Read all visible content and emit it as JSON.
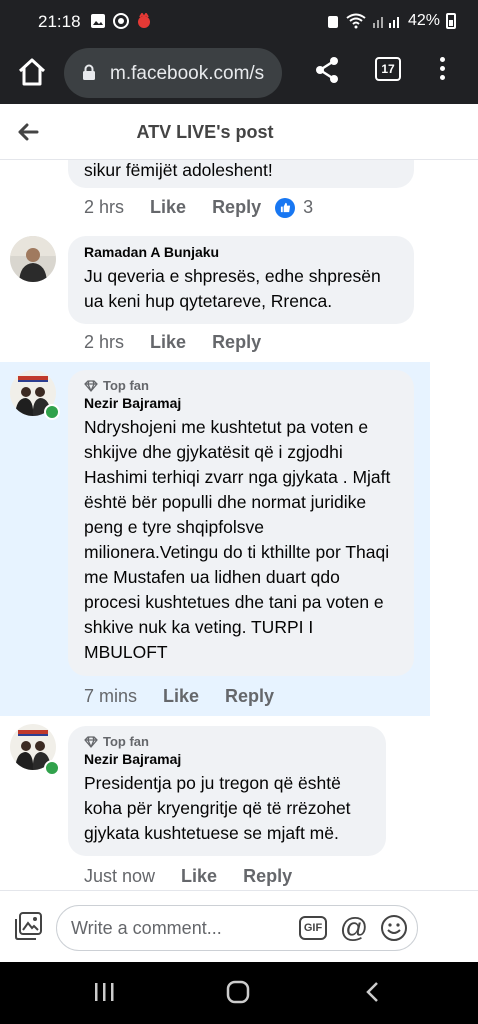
{
  "status": {
    "time": "21:18",
    "battery": "42%"
  },
  "browser": {
    "url": "m.facebook.com/s",
    "tab_count": "17"
  },
  "header": {
    "title": "ATV LIVE's post"
  },
  "comments": [
    {
      "text": "sikur fëmijët adoleshent!",
      "time": "2 hrs",
      "like_label": "Like",
      "reply_label": "Reply",
      "like_count": "3"
    },
    {
      "author": "Ramadan A Bunjaku",
      "text": "Ju qeveria e shpresës, edhe shpresën ua keni hup qytetareve, Rrenca.",
      "time": "2 hrs",
      "like_label": "Like",
      "reply_label": "Reply"
    },
    {
      "badge": "Top fan",
      "author": "Nezir Bajramaj",
      "text": "Ndryshojeni me kushtetut pa voten e shkijve dhe gjykatësit që i zgjodhi Hashimi terhiqi zvarr nga gjykata . Mjaft është bër populli dhe normat juridike peng e tyre shqipfolsve milionera.Vetingu do ti kthillte por Thaqi me Mustafen ua lidhen duart qdo procesi kushtetues  dhe tani pa voten e shkive nuk ka veting. TURPI I MBULOFT",
      "time": "7 mins",
      "like_label": "Like",
      "reply_label": "Reply"
    },
    {
      "badge": "Top fan",
      "author": "Nezir Bajramaj",
      "text": "Presidentja po ju tregon që është koha për kryengritje që të rrëzohet gjykata kushtetuese se mjaft më.",
      "time": "Just now",
      "like_label": "Like",
      "reply_label": "Reply"
    }
  ],
  "composer": {
    "placeholder": "Write a comment...",
    "gif_label": "GIF",
    "at_label": "@"
  },
  "colors": {
    "facebook_blue": "#1877f2",
    "online_green": "#31a24c",
    "highlight": "#e7f3ff"
  }
}
